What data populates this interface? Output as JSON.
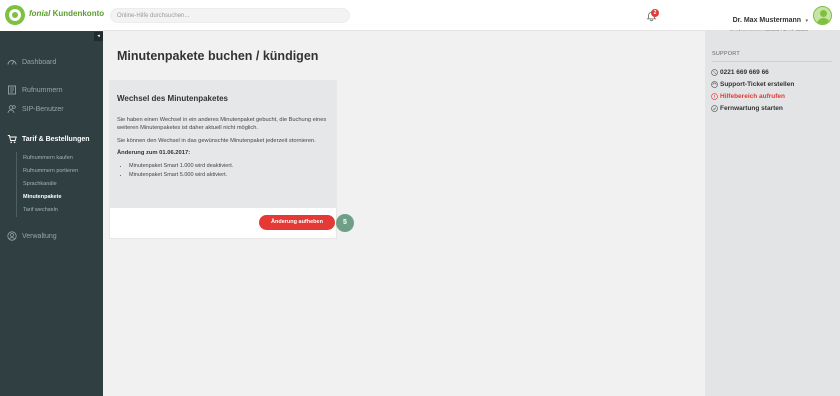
{
  "header": {
    "brand_name": "fonial",
    "brand_sub": "Kundenkonto",
    "search_placeholder": "Online-Hilfe durchsuchen...",
    "notification_count": "2",
    "user_name": "Dr. Max Mustermann",
    "user_caret": "▾",
    "user_meta": "Kundennummer: 000000 | Trunk 00000"
  },
  "sidebar": {
    "collapse": "◂",
    "items": [
      {
        "label": "Dashboard",
        "icon": "dashboard-icon"
      },
      {
        "label": "Rufnummern",
        "icon": "phone-book-icon"
      },
      {
        "label": "SIP-Benutzer",
        "icon": "users-icon"
      },
      {
        "label": "Tarif & Bestellungen",
        "icon": "cart-icon"
      },
      {
        "label": "Verwaltung",
        "icon": "user-circle-icon"
      }
    ],
    "sub_items": [
      {
        "label": "Rufnummern kaufen"
      },
      {
        "label": "Rufnummern portieren"
      },
      {
        "label": "Sprachkanäle"
      },
      {
        "label": "Minutenpakete"
      },
      {
        "label": "Tarif wechseln"
      }
    ]
  },
  "main": {
    "title": "Minutenpakete buchen / kündigen",
    "card": {
      "title": "Wechsel des Minutenpaketes",
      "p1": "Sie haben einen Wechsel in ein anderes Minutenpaket gebucht, die Buchung eines weiteren Minutenpaketes ist daher aktuell nicht möglich.",
      "p2": "Sie können den Wechsel in das gewünschte Minutenpaket jederzeit stornieren.",
      "change_heading": "Änderung zum 01.06.2017:",
      "changes": [
        "Minutenpaket Smart 1.000 wird deaktiviert.",
        "Minutenpaket Smart 5.000 wird aktiviert."
      ],
      "button_label": "Änderung aufheben",
      "step_number": "5"
    }
  },
  "support": {
    "heading": "SUPPORT",
    "phone": "0221 669 669 66",
    "ticket": "Support-Ticket erstellen",
    "help": "Hilfebereich aufrufen",
    "remote": "Fernwartung starten"
  },
  "colors": {
    "sidebar_bg": "#2f3f42",
    "accent_green": "#7ec142",
    "danger_red": "#e53935",
    "step_badge": "#6f9f87"
  }
}
